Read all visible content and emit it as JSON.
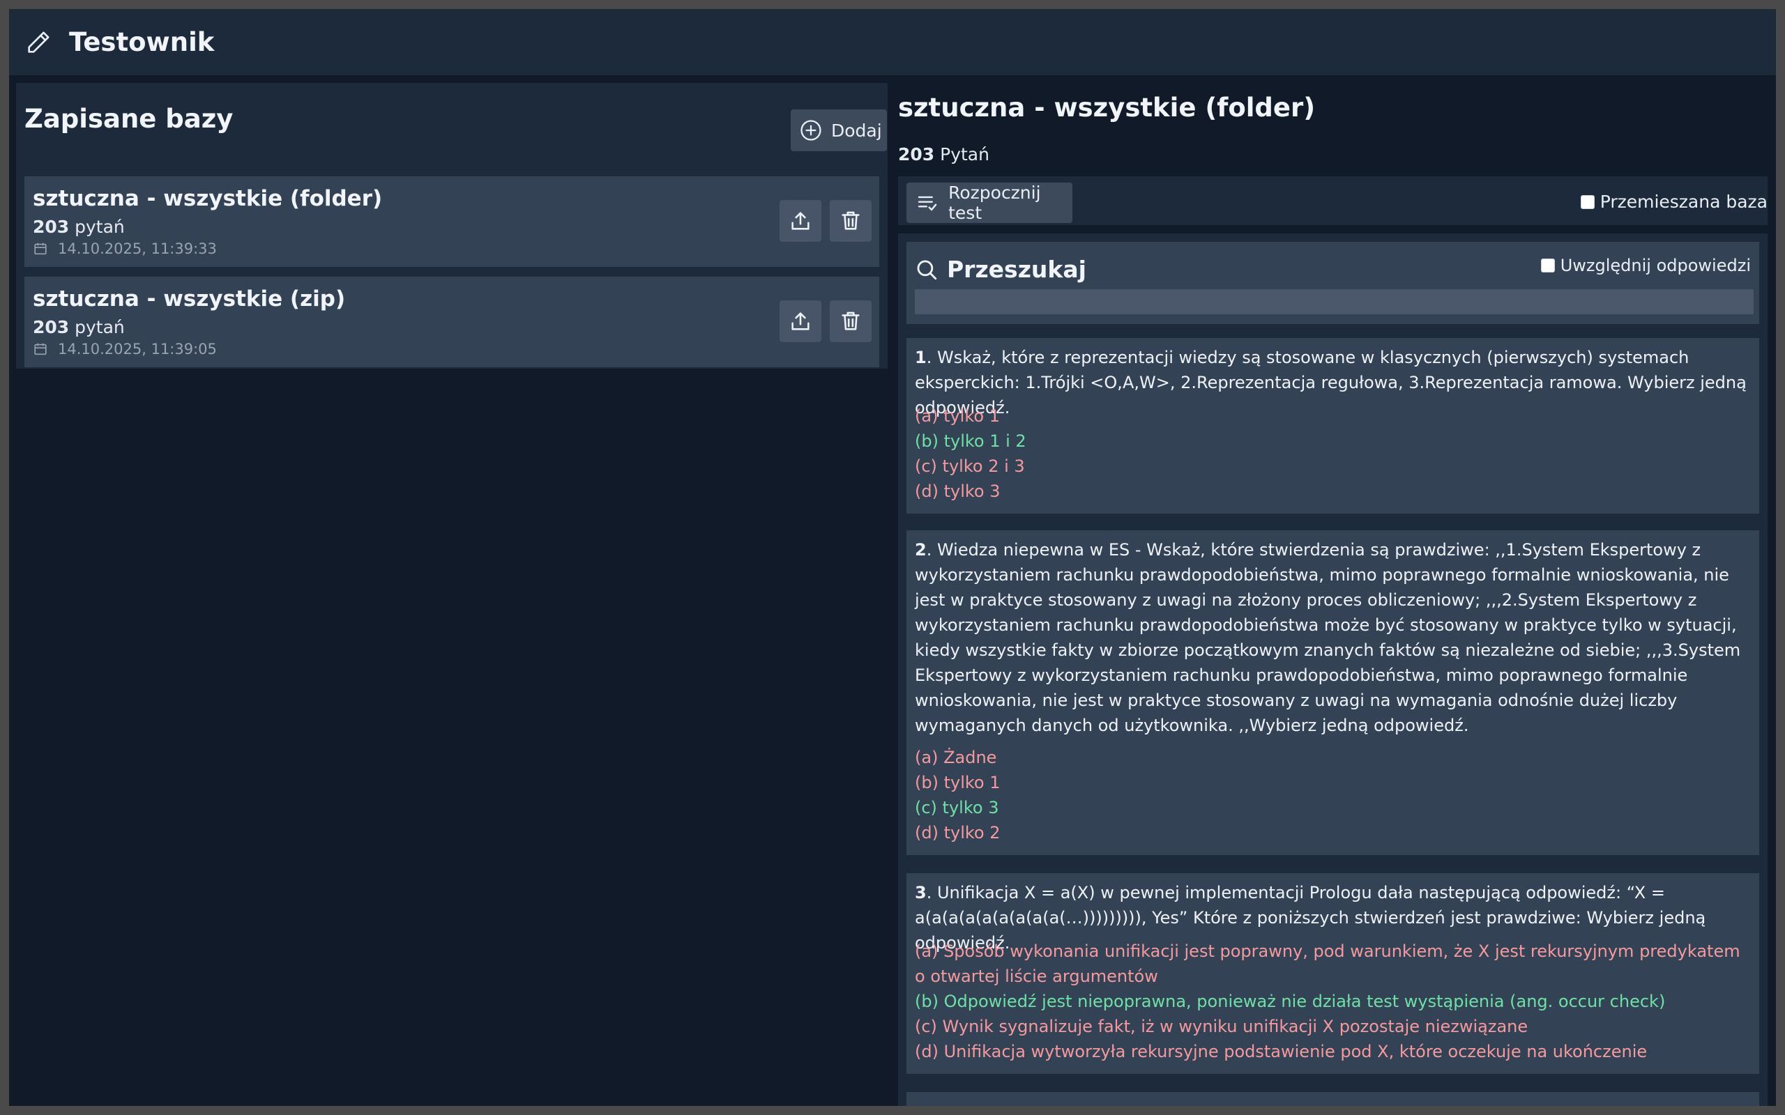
{
  "app": {
    "title": "Testownik"
  },
  "left": {
    "heading": "Zapisane bazy",
    "add_label": "Dodaj",
    "databases": [
      {
        "name": "sztuczna - wszystkie (folder)",
        "count": "203",
        "count_suffix": " pytań",
        "date": "14.10.2025, 11:39:33"
      },
      {
        "name": "sztuczna - wszystkie (zip)",
        "count": "203",
        "count_suffix": " pytań",
        "date": "14.10.2025, 11:39:05"
      }
    ]
  },
  "right": {
    "title": "sztuczna - wszystkie (folder)",
    "count": "203",
    "count_suffix": " Pytań",
    "start_label": "Rozpocznij test",
    "shuffle_label": "Przemieszana baza",
    "search": {
      "title": "Przeszukaj",
      "include_answers_label": "Uwzględnij odpowiedzi",
      "value": ""
    },
    "questions": [
      {
        "number": "1",
        "text": ". Wskaż, które z reprezentacji wiedzy są stosowane w klasycznych (pierwszych) systemach eksperckich: 1.Trójki <O,A,W>, 2.Reprezentacja regułowa, 3.Reprezentacja ramowa. Wybierz jedną odpowiedź.",
        "answers": [
          {
            "text": "(a) tylko 1",
            "correct": false
          },
          {
            "text": "(b) tylko 1 i 2",
            "correct": true
          },
          {
            "text": "(c) tylko 2 i 3",
            "correct": false
          },
          {
            "text": "(d) tylko 3",
            "correct": false
          }
        ]
      },
      {
        "number": "2",
        "text": ". Wiedza niepewna w ES - Wskaż, które stwierdzenia są prawdziwe: ,,1.System Ekspertowy z wykorzystaniem rachunku prawdopodobieństwa, mimo poprawnego formalnie wnioskowania, nie jest w praktyce stosowany z uwagi na złożony proces obliczeniowy; ,,,2.System Ekspertowy z wykorzystaniem rachunku prawdopodobieństwa może być stosowany w praktyce tylko w sytuacji, kiedy wszystkie fakty w zbiorze początkowym znanych faktów są niezależne od siebie; ,,,3.System Ekspertowy z wykorzystaniem rachunku prawdopodobieństwa, mimo poprawnego formalnie wnioskowania, nie jest w praktyce stosowany z uwagi na wymagania odnośnie dużej liczby wymaganych danych od użytkownika. ,,Wybierz jedną odpowiedź.",
        "answers": [
          {
            "text": "(a) Żadne",
            "correct": false
          },
          {
            "text": "(b) tylko 1",
            "correct": false
          },
          {
            "text": "(c) tylko 3",
            "correct": true
          },
          {
            "text": "(d) tylko 2",
            "correct": false
          }
        ]
      },
      {
        "number": "3",
        "text": ". Unifikacja X = a(X) w pewnej implementacji Prologu dała następującą odpowiedź: “X = a(a(a(a(a(a(a(a(a(…))))))))), Yes” Które z poniższych stwierdzeń jest prawdziwe: Wybierz jedną odpowiedź.",
        "answers": [
          {
            "text": "(a) Sposób wykonania unifikacji jest poprawny, pod warunkiem, że X jest rekursyjnym predykatem o otwartej liście argumentów",
            "correct": false
          },
          {
            "text": "(b) Odpowiedź jest niepoprawna, ponieważ nie działa test wystąpienia (ang. occur check)",
            "correct": true
          },
          {
            "text": "(c) Wynik sygnalizuje fakt, iż w wyniku unifikacji X pozostaje niezwiązane",
            "correct": false
          },
          {
            "text": "(d) Unifikacja wytworzyła rekursyjne podstawienie pod X, które oczekuje na ukończenie",
            "correct": false
          }
        ]
      }
    ]
  },
  "colors": {
    "correct": "#6fe0a5",
    "wrong": "#f39a9e",
    "panel": "#1d2a3b",
    "card": "#344256",
    "background": "#111a28"
  }
}
